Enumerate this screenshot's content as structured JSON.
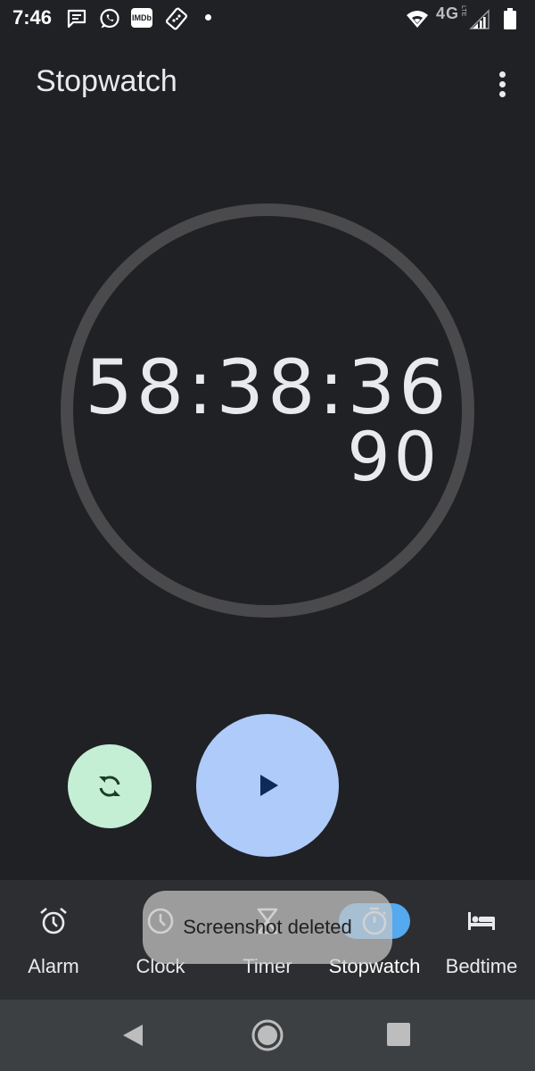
{
  "status_bar": {
    "time": "7:46",
    "imdb_label": "IMDb",
    "network_type": "4G",
    "network_sub": "LTE",
    "icons": [
      "messages-icon",
      "whatsapp-icon",
      "imdb-icon",
      "dominos-icon",
      "wifi-icon",
      "signal-icon",
      "battery-icon"
    ]
  },
  "app_bar": {
    "title": "Stopwatch",
    "menu_icon": "more-vert-icon"
  },
  "stopwatch": {
    "elapsed": "58:38:36",
    "hundredths": "90"
  },
  "controls": {
    "reset_icon": "reset-icon",
    "play_icon": "play-icon",
    "reset_color": "#c4efd4",
    "play_color": "#aecbfa"
  },
  "bottom_nav": {
    "active": "Stopwatch",
    "active_color": "#55a9ee",
    "items": [
      {
        "label": "Alarm",
        "icon": "alarm-icon"
      },
      {
        "label": "Clock",
        "icon": "clock-icon"
      },
      {
        "label": "Timer",
        "icon": "hourglass-icon"
      },
      {
        "label": "Stopwatch",
        "icon": "stopwatch-icon"
      },
      {
        "label": "Bedtime",
        "icon": "bed-icon"
      }
    ]
  },
  "toast": {
    "text": "Screenshot deleted"
  },
  "system_nav": {
    "icons": [
      "back-icon",
      "home-icon",
      "recents-icon"
    ]
  }
}
